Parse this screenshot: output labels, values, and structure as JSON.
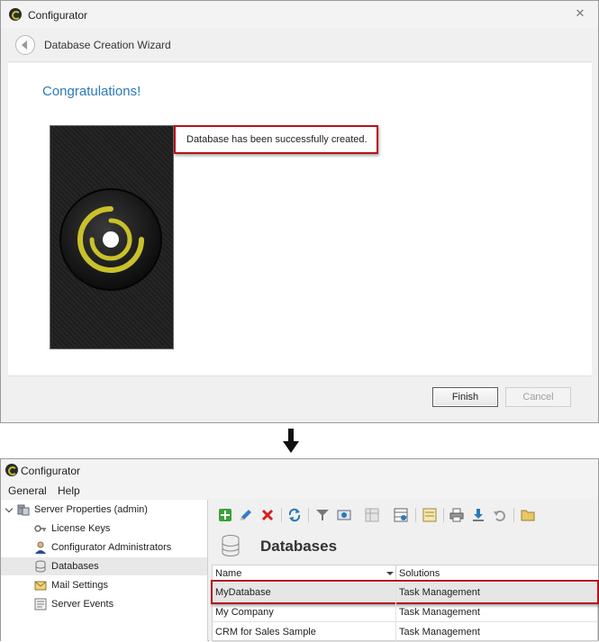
{
  "wizard_window": {
    "title": "Configurator",
    "close_glyph": "✕",
    "header_title": "Database Creation Wizard",
    "congrats": "Congratulations!",
    "message": "Database has been successfully created.",
    "buttons": {
      "finish": "Finish",
      "cancel": "Cancel"
    },
    "icons": [
      "app-logo-icon",
      "close-icon",
      "back-arrow-icon",
      "splash-logo"
    ]
  },
  "main_window": {
    "title": "Configurator",
    "menu": [
      "General",
      "Help"
    ],
    "tree": {
      "root": "Server Properties (admin)",
      "children": [
        "License Keys",
        "Configurator Administrators",
        "Databases",
        "Mail Settings",
        "Server Events"
      ],
      "selected": "Databases"
    },
    "toolbar_icons": [
      "add-icon",
      "edit-icon",
      "delete-icon",
      "refresh-icon",
      "filter-icon",
      "view-icon",
      "layout-icon",
      "grid-settings-icon",
      "export-icon",
      "print-icon",
      "download-icon",
      "restore-icon",
      "folder-icon"
    ],
    "page_title": "Databases",
    "grid": {
      "columns": [
        "Name",
        "Solutions"
      ],
      "rows": [
        [
          "MyDatabase",
          "Task Management"
        ],
        [
          "My Company",
          "Task Management"
        ],
        [
          "CRM for Sales Sample",
          "Task Management"
        ]
      ],
      "highlighted_row": "MyDatabase"
    }
  },
  "colors": {
    "accent_blue": "#2a7ab8",
    "highlight_red": "#b5121b",
    "logo_yellow": "#c9c12a"
  }
}
